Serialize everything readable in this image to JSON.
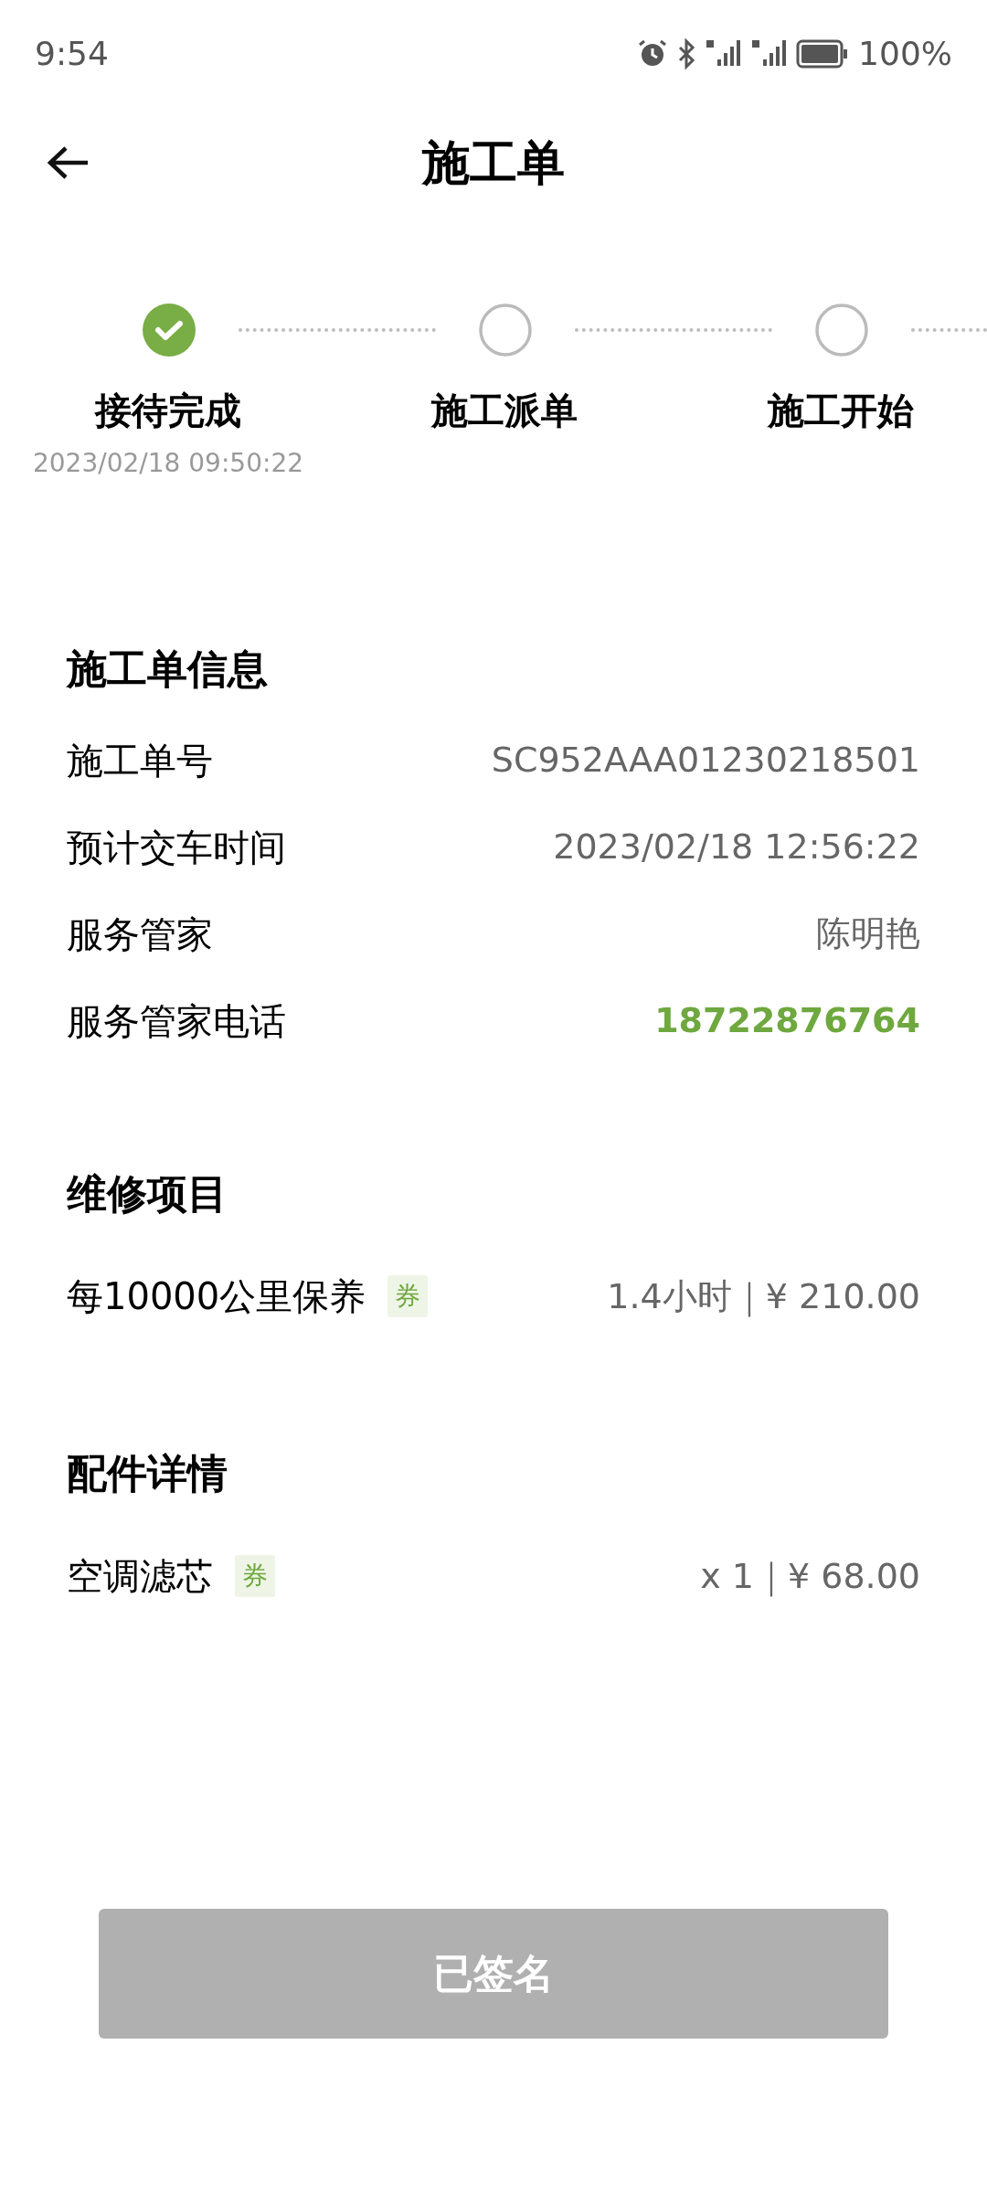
{
  "status_bar": {
    "time": "9:54",
    "battery": "100%"
  },
  "header": {
    "title": "施工单"
  },
  "steps": [
    {
      "label": "接待完成",
      "completed": true,
      "time": "2023/02/18 09:50:22"
    },
    {
      "label": "施工派单",
      "completed": false
    },
    {
      "label": "施工开始",
      "completed": false
    }
  ],
  "info": {
    "title": "施工单信息",
    "rows": [
      {
        "label": "施工单号",
        "value": "SC952AAA01230218501",
        "kind": "text"
      },
      {
        "label": "预计交车时间",
        "value": "2023/02/18 12:56:22",
        "kind": "text"
      },
      {
        "label": "服务管家",
        "value": "陈明艳",
        "kind": "text"
      },
      {
        "label": "服务管家电话",
        "value": "18722876764",
        "kind": "phone"
      }
    ]
  },
  "repair_items": {
    "title": "维修项目",
    "rows": [
      {
        "name": "每10000公里保养",
        "tag": "券",
        "value": "1.4小时｜¥ 210.00"
      }
    ]
  },
  "parts": {
    "title": "配件详情",
    "rows": [
      {
        "name": "空调滤芯",
        "tag": "券",
        "value": "x 1｜¥ 68.00"
      }
    ]
  },
  "button": {
    "label": "已签名",
    "disabled": true
  }
}
